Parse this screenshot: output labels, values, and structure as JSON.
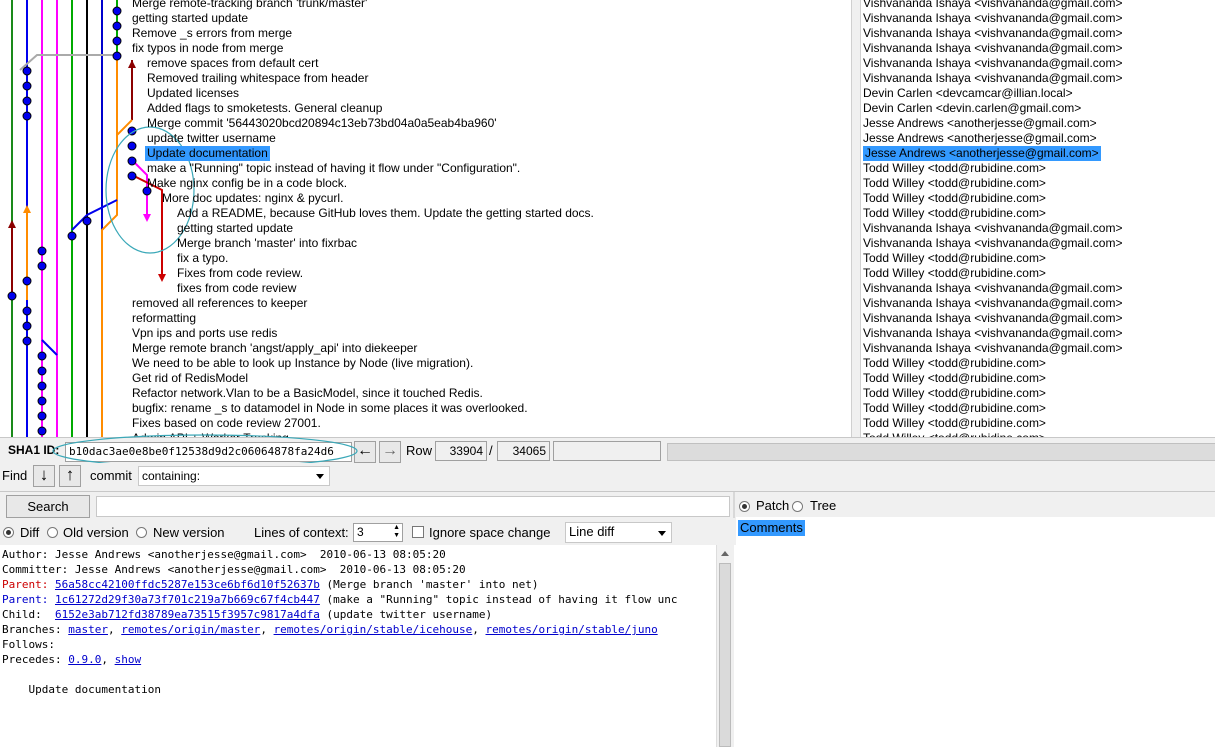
{
  "commits": [
    {
      "subject": "Merge remote-tracking branch 'trunk/master'"
    },
    {
      "subject": "getting started update"
    },
    {
      "subject": "Remove _s errors from merge"
    },
    {
      "subject": "fix typos in node from merge"
    },
    {
      "subject": "remove spaces from default cert"
    },
    {
      "subject": "Removed trailing whitespace from header"
    },
    {
      "subject": "Updated licenses"
    },
    {
      "subject": "Added flags to smoketests. General cleanup"
    },
    {
      "subject": "Merge commit '56443020bcd20894c13eb73bd04a0a5eab4ba960'"
    },
    {
      "subject": "update twitter username"
    },
    {
      "subject": "Update documentation"
    },
    {
      "subject": "make a \"Running\" topic instead of having it flow under \"Configuration\"."
    },
    {
      "subject": "Make nginx config be in a code block."
    },
    {
      "subject": "More doc updates: nginx & pycurl."
    },
    {
      "subject": "Add a README, because GitHub loves them.  Update the getting started docs."
    },
    {
      "subject": "getting started update"
    },
    {
      "subject": "Merge branch 'master' into fixrbac"
    },
    {
      "subject": "fix a typo."
    },
    {
      "subject": "Fixes from code review."
    },
    {
      "subject": "fixes from code review"
    },
    {
      "subject": "removed all references to keeper"
    },
    {
      "subject": "reformatting"
    },
    {
      "subject": "Vpn ips and ports use redis"
    },
    {
      "subject": "Merge remote branch 'angst/apply_api' into diekeeper"
    },
    {
      "subject": "We need to be able to look up Instance by Node (live migration)."
    },
    {
      "subject": "Get rid of RedisModel"
    },
    {
      "subject": "Refactor network.Vlan to be a BasicModel, since it touched Redis."
    },
    {
      "subject": "bugfix: rename _s to datamodel in Node in some places it was overlooked."
    },
    {
      "subject": "Fixes based on code review 27001."
    },
    {
      "subject": "Admin API + Worker Tracking."
    }
  ],
  "authors": [
    "Vishvananda Ishaya <vishvananda@gmail.com>",
    "Vishvananda Ishaya <vishvananda@gmail.com>",
    "Vishvananda Ishaya <vishvananda@gmail.com>",
    "Vishvananda Ishaya <vishvananda@gmail.com>",
    "Vishvananda Ishaya <vishvananda@gmail.com>",
    "Vishvananda Ishaya <vishvananda@gmail.com>",
    "Devin Carlen <devcamcar@illian.local>",
    "Devin Carlen <devin.carlen@gmail.com>",
    "Jesse Andrews <anotherjesse@gmail.com>",
    "Jesse Andrews <anotherjesse@gmail.com>",
    "Jesse Andrews <anotherjesse@gmail.com>",
    "Todd Willey <todd@rubidine.com>",
    "Todd Willey <todd@rubidine.com>",
    "Todd Willey <todd@rubidine.com>",
    "Todd Willey <todd@rubidine.com>",
    "Vishvananda Ishaya <vishvananda@gmail.com>",
    "Vishvananda Ishaya <vishvananda@gmail.com>",
    "Todd Willey <todd@rubidine.com>",
    "Todd Willey <todd@rubidine.com>",
    "Vishvananda Ishaya <vishvananda@gmail.com>",
    "Vishvananda Ishaya <vishvananda@gmail.com>",
    "Vishvananda Ishaya <vishvananda@gmail.com>",
    "Vishvananda Ishaya <vishvananda@gmail.com>",
    "Vishvananda Ishaya <vishvananda@gmail.com>",
    "Todd Willey <todd@rubidine.com>",
    "Todd Willey <todd@rubidine.com>",
    "Todd Willey <todd@rubidine.com>",
    "Todd Willey <todd@rubidine.com>",
    "Todd Willey <todd@rubidine.com>",
    "Todd Willey <todd@rubidine.com>"
  ],
  "selected_index": 10,
  "sha_bar": {
    "label": "SHA1 ID:",
    "value": "b10dac3ae0e8be0f12538d9d2c06064878fa24d6",
    "row_label": "Row",
    "row_value": "33904",
    "row_sep": "/",
    "row_total": "34065"
  },
  "find_bar": {
    "label": "Find",
    "mode": "commit",
    "filter": "containing:"
  },
  "search": {
    "button": "Search",
    "value": ""
  },
  "diff_options": {
    "diff": "Diff",
    "old_version": "Old version",
    "new_version": "New version",
    "context_label": "Lines of context:",
    "context_value": "3",
    "ignore_space": "Ignore space change",
    "diff_mode": "Line diff"
  },
  "right_pane": {
    "patch": "Patch",
    "tree": "Tree",
    "comments": "Comments"
  },
  "details": {
    "author": "Author: Jesse Andrews <anotherjesse@gmail.com>  2010-06-13 08:05:20",
    "committer": "Committer: Jesse Andrews <anotherjesse@gmail.com>  2010-06-13 08:05:20",
    "parent1_label": "Parent: ",
    "parent1_sha": "56a58cc42100ffdc5287e153ce6bf6d10f52637b",
    "parent1_msg": " (Merge branch 'master' into net)",
    "parent2_label": "Parent: ",
    "parent2_sha": "1c61272d29f30a73f701c219a7b669c67f4cb447",
    "parent2_msg": " (make a \"Running\" topic instead of having it flow unc",
    "child_label": "Child:  ",
    "child_sha": "6152e3ab712fd38789ea73515f3957c9817a4dfa",
    "child_msg": " (update twitter username)",
    "branches_label": "Branches: ",
    "branches": [
      "master",
      "remotes/origin/master",
      "remotes/origin/stable/icehouse",
      "remotes/origin/stable/juno"
    ],
    "follows": "Follows:",
    "precedes_label": "Precedes: ",
    "precedes": [
      "0.9.0",
      "show"
    ],
    "message": "    Update documentation"
  },
  "colors": {
    "selection": "#3399ff",
    "annotation": "#3aa8b8",
    "node": "#0000ee"
  }
}
